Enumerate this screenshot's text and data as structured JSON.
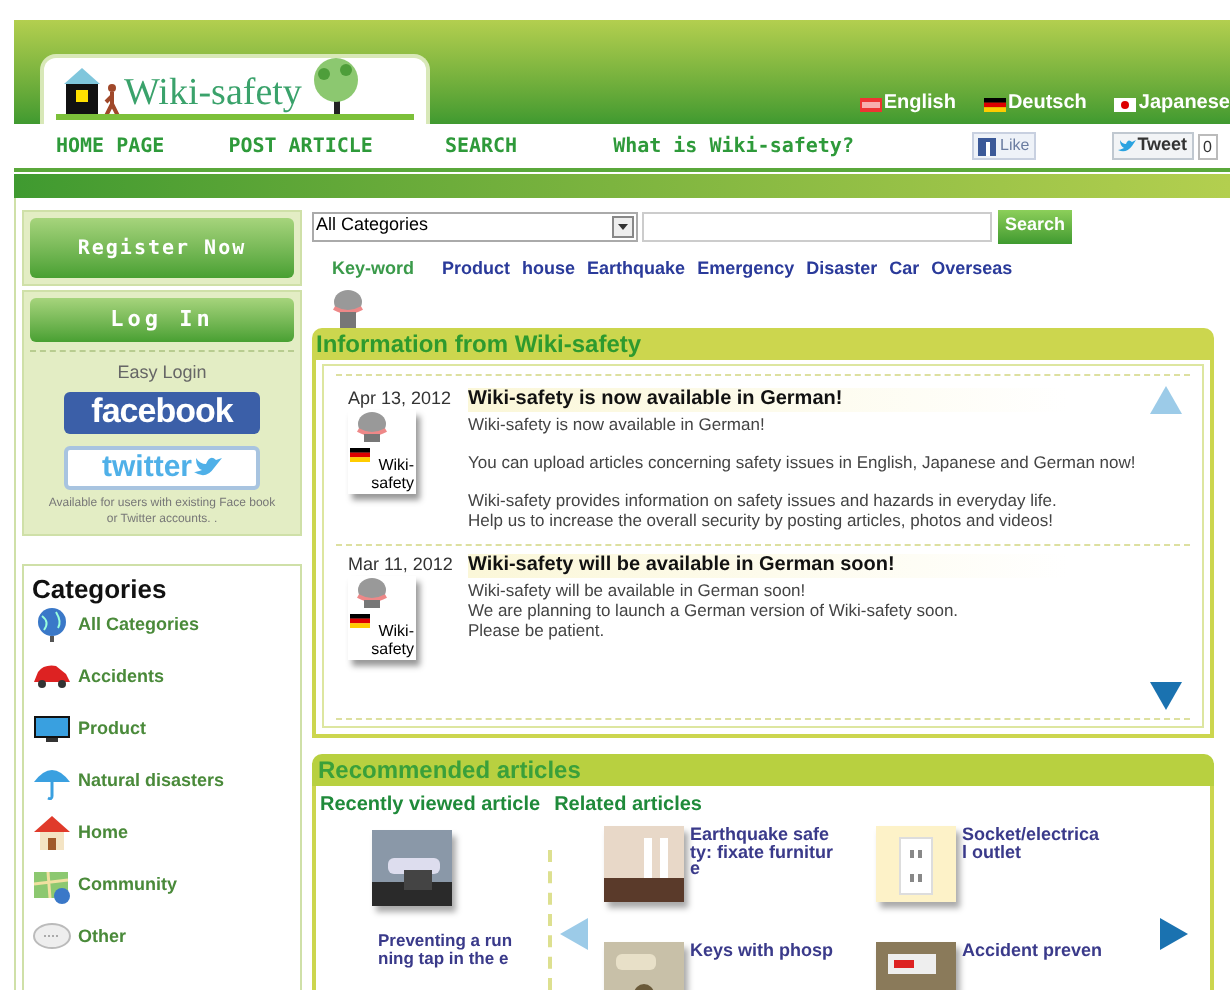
{
  "header": {
    "logo": "Wiki-safety",
    "languages": [
      {
        "label": "English",
        "kind": "abc"
      },
      {
        "label": "Deutsch",
        "kind": "de"
      },
      {
        "label": "Japanese",
        "kind": "jp"
      }
    ]
  },
  "nav": [
    "HOME PAGE",
    "POST ARTICLE",
    "SEARCH",
    "What is Wiki-safety?"
  ],
  "social": {
    "like": "Like",
    "tweet": "Tweet",
    "tweet_count": "0"
  },
  "sidebar": {
    "register": "Register Now",
    "login": "Log In",
    "easy_login": "Easy Login",
    "facebook": "facebook",
    "twitter": "twitter",
    "note": "Available for users with existing Face book or Twitter accounts. .",
    "categories_title": "Categories",
    "categories": [
      {
        "label": "All Categories",
        "kind": "globe"
      },
      {
        "label": "Accidents",
        "kind": "car"
      },
      {
        "label": "Product",
        "kind": "monitor"
      },
      {
        "label": "Natural disasters",
        "kind": "umbrella"
      },
      {
        "label": "Home",
        "kind": "house"
      },
      {
        "label": "Community",
        "kind": "map"
      },
      {
        "label": "Other",
        "kind": "bubble"
      }
    ]
  },
  "search": {
    "select": "All Categories",
    "button": "Search"
  },
  "keywords": {
    "label": "Key-word",
    "items": [
      "Product",
      "house",
      "Earthquake",
      "Emergency",
      "Disaster",
      "Car",
      "Overseas"
    ]
  },
  "info": {
    "title": "Information from Wiki-safety",
    "posts": [
      {
        "date": "Apr 13, 2012",
        "badge": [
          "Wiki-",
          "safety"
        ],
        "title": "Wiki-safety is now available in German!",
        "paragraphs": [
          [
            "Wiki-safety is now available in German!"
          ],
          [
            "You can upload articles concerning safety issues in English, Japanese and German now!"
          ],
          [
            "Wiki-safety provides information on safety issues and hazards in everyday life.",
            "Help us to increase the overall security by posting articles, photos and videos!"
          ]
        ]
      },
      {
        "date": "Mar 11, 2012",
        "badge": [
          "Wiki-",
          "safety"
        ],
        "title": "Wiki-safety will be available in German soon!",
        "paragraphs": [
          [
            "Wiki-safety will be available in German soon!",
            "We are planning to launch a German version of Wiki-safety soon.",
            "Please be patient."
          ]
        ]
      }
    ]
  },
  "recommended": {
    "title": "Recommended articles",
    "recent_title": "Recently viewed article",
    "related_title": "Related articles",
    "recent": {
      "lines": [
        "Preventing a run",
        "ning tap in the e"
      ]
    },
    "related": [
      {
        "lines": [
          "Earthquake safe",
          "ty: fixate furnitur",
          "e"
        ],
        "kind": "shelf"
      },
      {
        "lines": [
          "Socket/electrica",
          "l outlet"
        ],
        "kind": "socket"
      },
      {
        "lines": [
          "Keys with phosp"
        ],
        "kind": "keys"
      },
      {
        "lines": [
          "Accident preven"
        ],
        "kind": "panel"
      }
    ]
  }
}
